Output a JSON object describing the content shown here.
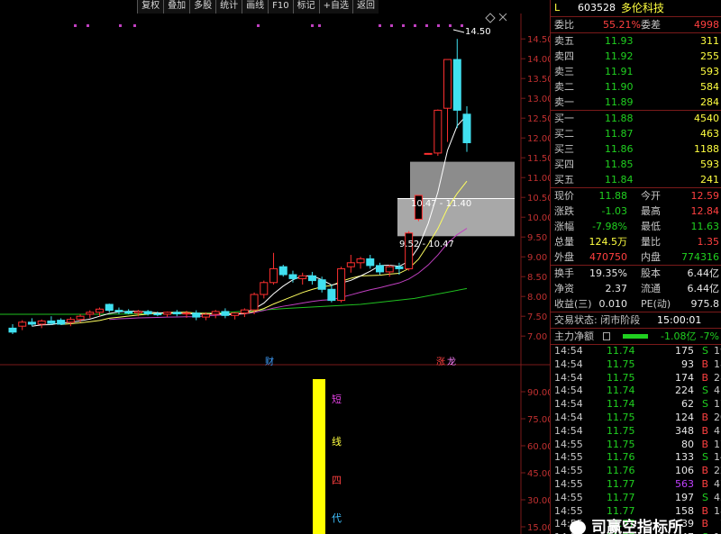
{
  "toolbar": {
    "buttons": [
      "复权",
      "叠加",
      "多股",
      "统计",
      "画线",
      "F10",
      "标记",
      "+自选",
      "返回"
    ]
  },
  "chart": {
    "price_ticks": [
      "14.50",
      "14.00",
      "13.50",
      "13.00",
      "12.50",
      "12.00",
      "11.50",
      "11.00",
      "10.50",
      "10.00",
      "9.50",
      "9.00",
      "8.50",
      "8.00",
      "7.50",
      "7.00"
    ],
    "indicator_ticks": [
      "90.00",
      "75.00",
      "60.00",
      "45.00",
      "30.00",
      "15.00"
    ],
    "high_label": "14.50",
    "zone_upper_label": "10.47 - 11.40",
    "zone_lower_label": "9.52 - 10.47",
    "event_markers": [
      "财",
      "涨",
      "龙"
    ],
    "vertical_text": [
      "短",
      "线",
      "四",
      "代"
    ]
  },
  "chart_data": {
    "type": "candlestick",
    "ylim": [
      6.8,
      14.8
    ],
    "candles": [
      {
        "o": 7.2,
        "h": 7.3,
        "l": 7.05,
        "c": 7.1
      },
      {
        "o": 7.25,
        "h": 7.4,
        "l": 7.15,
        "c": 7.35
      },
      {
        "o": 7.35,
        "h": 7.45,
        "l": 7.25,
        "c": 7.3
      },
      {
        "o": 7.3,
        "h": 7.42,
        "l": 7.2,
        "c": 7.38
      },
      {
        "o": 7.38,
        "h": 7.5,
        "l": 7.28,
        "c": 7.32
      },
      {
        "o": 7.4,
        "h": 7.45,
        "l": 7.28,
        "c": 7.3
      },
      {
        "o": 7.35,
        "h": 7.48,
        "l": 7.25,
        "c": 7.42
      },
      {
        "o": 7.42,
        "h": 7.55,
        "l": 7.35,
        "c": 7.5
      },
      {
        "o": 7.55,
        "h": 7.65,
        "l": 7.45,
        "c": 7.6
      },
      {
        "o": 7.6,
        "h": 7.72,
        "l": 7.5,
        "c": 7.68
      },
      {
        "o": 7.8,
        "h": 7.82,
        "l": 7.6,
        "c": 7.65
      },
      {
        "o": 7.65,
        "h": 7.72,
        "l": 7.55,
        "c": 7.62
      },
      {
        "o": 7.62,
        "h": 7.68,
        "l": 7.55,
        "c": 7.58
      },
      {
        "o": 7.58,
        "h": 7.66,
        "l": 7.5,
        "c": 7.62
      },
      {
        "o": 7.62,
        "h": 7.66,
        "l": 7.52,
        "c": 7.56
      },
      {
        "o": 7.56,
        "h": 7.62,
        "l": 7.5,
        "c": 7.55
      },
      {
        "o": 7.55,
        "h": 7.62,
        "l": 7.48,
        "c": 7.6
      },
      {
        "o": 7.6,
        "h": 7.66,
        "l": 7.5,
        "c": 7.56
      },
      {
        "o": 7.56,
        "h": 7.64,
        "l": 7.46,
        "c": 7.58
      },
      {
        "o": 7.58,
        "h": 7.65,
        "l": 7.4,
        "c": 7.48
      },
      {
        "o": 7.48,
        "h": 7.6,
        "l": 7.4,
        "c": 7.55
      },
      {
        "o": 7.55,
        "h": 7.66,
        "l": 7.45,
        "c": 7.62
      },
      {
        "o": 7.62,
        "h": 7.7,
        "l": 7.45,
        "c": 7.52
      },
      {
        "o": 7.52,
        "h": 7.6,
        "l": 7.42,
        "c": 7.58
      },
      {
        "o": 7.58,
        "h": 7.7,
        "l": 7.48,
        "c": 7.66
      },
      {
        "o": 7.66,
        "h": 8.1,
        "l": 7.55,
        "c": 8.05
      },
      {
        "o": 8.05,
        "h": 8.4,
        "l": 7.95,
        "c": 8.35
      },
      {
        "o": 8.35,
        "h": 9.1,
        "l": 8.3,
        "c": 8.7
      },
      {
        "o": 8.75,
        "h": 8.8,
        "l": 8.5,
        "c": 8.55
      },
      {
        "o": 8.55,
        "h": 8.65,
        "l": 8.35,
        "c": 8.45
      },
      {
        "o": 8.45,
        "h": 8.6,
        "l": 8.3,
        "c": 8.52
      },
      {
        "o": 8.52,
        "h": 8.62,
        "l": 8.3,
        "c": 8.4
      },
      {
        "o": 8.42,
        "h": 8.5,
        "l": 8.1,
        "c": 8.18
      },
      {
        "o": 8.18,
        "h": 8.3,
        "l": 7.85,
        "c": 7.9
      },
      {
        "o": 7.9,
        "h": 8.75,
        "l": 7.85,
        "c": 8.7
      },
      {
        "o": 8.75,
        "h": 9.05,
        "l": 8.6,
        "c": 8.85
      },
      {
        "o": 8.85,
        "h": 9.0,
        "l": 8.7,
        "c": 8.95
      },
      {
        "o": 8.95,
        "h": 9.05,
        "l": 8.7,
        "c": 8.78
      },
      {
        "o": 8.78,
        "h": 8.85,
        "l": 8.55,
        "c": 8.62
      },
      {
        "o": 8.62,
        "h": 8.8,
        "l": 8.5,
        "c": 8.75
      },
      {
        "o": 8.75,
        "h": 8.85,
        "l": 8.55,
        "c": 8.7
      },
      {
        "o": 8.7,
        "h": 9.65,
        "l": 8.65,
        "c": 9.6
      },
      {
        "o": 9.95,
        "h": 10.55,
        "l": 9.9,
        "c": 10.55
      },
      {
        "o": 11.6,
        "h": 11.62,
        "l": 11.58,
        "c": 11.61
      },
      {
        "o": 11.62,
        "h": 12.72,
        "l": 11.55,
        "c": 12.7
      },
      {
        "o": 12.75,
        "h": 13.98,
        "l": 11.9,
        "c": 13.98
      },
      {
        "o": 13.98,
        "h": 14.5,
        "l": 12.25,
        "c": 12.7
      },
      {
        "o": 12.6,
        "h": 12.8,
        "l": 11.65,
        "c": 11.88
      }
    ],
    "zones": [
      {
        "low": 10.47,
        "high": 11.4
      },
      {
        "low": 9.52,
        "high": 10.47
      }
    ]
  },
  "quote": {
    "code": "603528",
    "name": "多伦科技",
    "prefix": "L",
    "committee_label": "委比",
    "committee_value": "55.21%",
    "diff_label": "委差",
    "diff_value": "4998",
    "asks": [
      {
        "label": "卖五",
        "price": "11.93",
        "vol": "311"
      },
      {
        "label": "卖四",
        "price": "11.92",
        "vol": "255"
      },
      {
        "label": "卖三",
        "price": "11.91",
        "vol": "593"
      },
      {
        "label": "卖二",
        "price": "11.90",
        "vol": "584"
      },
      {
        "label": "卖一",
        "price": "11.89",
        "vol": "284"
      }
    ],
    "bids": [
      {
        "label": "买一",
        "price": "11.88",
        "vol": "4540"
      },
      {
        "label": "买二",
        "price": "11.87",
        "vol": "463"
      },
      {
        "label": "买三",
        "price": "11.86",
        "vol": "1188"
      },
      {
        "label": "买四",
        "price": "11.85",
        "vol": "593"
      },
      {
        "label": "买五",
        "price": "11.84",
        "vol": "241"
      }
    ],
    "stats": [
      {
        "l1": "现价",
        "v1": "11.88",
        "l2": "今开",
        "v2": "12.59",
        "c1": "green",
        "c2": "red"
      },
      {
        "l1": "涨跌",
        "v1": "-1.03",
        "l2": "最高",
        "v2": "12.84",
        "c1": "green",
        "c2": "red"
      },
      {
        "l1": "涨幅",
        "v1": "-7.98%",
        "l2": "最低",
        "v2": "11.63",
        "c1": "green",
        "c2": "green"
      },
      {
        "l1": "总量",
        "v1": "124.5万",
        "l2": "量比",
        "v2": "1.35",
        "c1": "yellow",
        "c2": "red"
      },
      {
        "l1": "外盘",
        "v1": "470750",
        "l2": "内盘",
        "v2": "774316",
        "c1": "red",
        "c2": "green"
      }
    ],
    "stats2": [
      {
        "l1": "换手",
        "v1": "19.35%",
        "l2": "股本",
        "v2": "6.44亿"
      },
      {
        "l1": "净资",
        "v1": "2.37",
        "l2": "流通",
        "v2": "6.44亿"
      },
      {
        "l1": "收益(三)",
        "v1": "0.010",
        "l2": "PE(动)",
        "v2": "975.8"
      }
    ],
    "trade_status": "交易状态: 闭市阶段",
    "trade_time": "15:00:01",
    "mainforce_label": "主力净额",
    "mainforce_value": "-1.08亿",
    "mainforce_pct": "-7%",
    "ticks": [
      {
        "t": "14:54",
        "p": "11.74",
        "v": "175",
        "bs": "S",
        "n": "19",
        "pc": "green",
        "vc": "white"
      },
      {
        "t": "14:54",
        "p": "11.75",
        "v": "93",
        "bs": "B",
        "n": "18",
        "pc": "green",
        "vc": "white"
      },
      {
        "t": "14:54",
        "p": "11.75",
        "v": "174",
        "bs": "B",
        "n": "28",
        "pc": "green",
        "vc": "white"
      },
      {
        "t": "14:54",
        "p": "11.74",
        "v": "224",
        "bs": "S",
        "n": "41",
        "pc": "green",
        "vc": "white"
      },
      {
        "t": "14:54",
        "p": "11.74",
        "v": "62",
        "bs": "S",
        "n": "17",
        "pc": "green",
        "vc": "white"
      },
      {
        "t": "14:54",
        "p": "11.75",
        "v": "124",
        "bs": "B",
        "n": "20",
        "pc": "green",
        "vc": "white"
      },
      {
        "t": "14:54",
        "p": "11.75",
        "v": "348",
        "bs": "B",
        "n": "41",
        "pc": "green",
        "vc": "white"
      },
      {
        "t": "14:55",
        "p": "11.75",
        "v": "80",
        "bs": "B",
        "n": "17",
        "pc": "green",
        "vc": "white"
      },
      {
        "t": "14:55",
        "p": "11.76",
        "v": "133",
        "bs": "S",
        "n": "14",
        "pc": "green",
        "vc": "white"
      },
      {
        "t": "14:55",
        "p": "11.76",
        "v": "106",
        "bs": "B",
        "n": "22",
        "pc": "green",
        "vc": "white"
      },
      {
        "t": "14:55",
        "p": "11.77",
        "v": "563",
        "bs": "B",
        "n": "47",
        "pc": "green",
        "vc": "purple"
      },
      {
        "t": "14:55",
        "p": "11.77",
        "v": "197",
        "bs": "S",
        "n": "45",
        "pc": "green",
        "vc": "white"
      },
      {
        "t": "14:55",
        "p": "11.77",
        "v": "158",
        "bs": "B",
        "n": "18",
        "pc": "green",
        "vc": "white"
      },
      {
        "t": "14:55",
        "p": "11.77",
        "v": "39",
        "bs": "B",
        "n": "7",
        "pc": "green",
        "vc": "white"
      },
      {
        "t": "14:55",
        "p": "11.77",
        "v": "47",
        "bs": "S",
        "n": "11",
        "pc": "green",
        "vc": "white"
      },
      {
        "t": "14:55",
        "p": "11.77",
        "v": "313",
        "bs": "S",
        "n": "29",
        "pc": "green",
        "vc": "white"
      }
    ]
  },
  "watermark": "司赢空指标所"
}
